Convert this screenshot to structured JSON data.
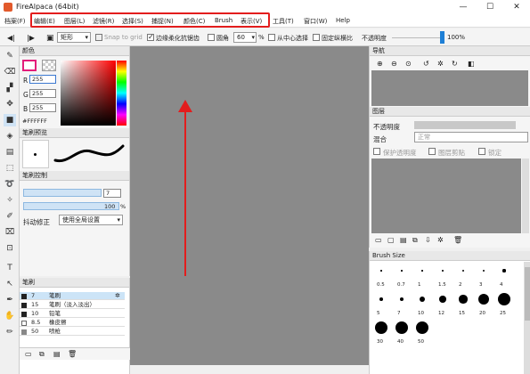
{
  "window": {
    "title": "FireAlpaca (64bit)",
    "minimize": "—",
    "maximize": "☐",
    "close": "✕"
  },
  "menu": [
    "档案(F)",
    "编辑(E)",
    "图层(L)",
    "滤镜(R)",
    "选择(S)",
    "捕捉(N)",
    "颜色(C)",
    "Brush",
    "表示(V)",
    "工具(T)",
    "窗口(W)",
    "Help"
  ],
  "toolbar": {
    "shape": "矩形",
    "snap_label": "Snap to grid",
    "antialias_label": "边缘柔化抗锯齿",
    "circle_label": "圆角",
    "radius_value": "60",
    "radius_unit": "%",
    "from_center_label": "从中心选择",
    "fixed_ratio_label": "固定纵横比",
    "opacity_label": "不透明度",
    "opacity_value": "100%",
    "opacity_fraction": 1.0
  },
  "color_panel": {
    "title": "颜色",
    "r_label": "R",
    "r_value": "255",
    "g_label": "G",
    "g_value": "255",
    "b_label": "B",
    "b_value": "255",
    "hex": "#FFFFFF"
  },
  "brush_preview": {
    "title": "笔刷预览"
  },
  "brush_control": {
    "title": "笔刷控制",
    "size_value": "7",
    "opacity_value": "100",
    "opacity_unit": "%",
    "stabilizer_label": "抖动修正",
    "stabilizer_value": "使用全局设置"
  },
  "brush_list": {
    "title": "笔刷",
    "items": [
      {
        "size": "7",
        "name": "笔刷"
      },
      {
        "size": "15",
        "name": "笔刷（淡入淡出）"
      },
      {
        "size": "10",
        "name": "铅笔"
      },
      {
        "size": "8.5",
        "name": "橡皮擦"
      },
      {
        "size": "50",
        "name": "喷枪"
      }
    ]
  },
  "navigator": {
    "title": "导航"
  },
  "layer_panel": {
    "title": "图层",
    "opacity_label": "不透明度",
    "blend_label": "混合",
    "blend_value": "正常",
    "protect_label": "保护透明度",
    "clip_label": "图层剪贴",
    "lock_label": "锁定"
  },
  "brush_size": {
    "title": "Brush Size",
    "sizes": [
      "0.5",
      "0.7",
      "1",
      "1.5",
      "2",
      "3",
      "4",
      "5",
      "7",
      "10",
      "12",
      "15",
      "20",
      "25",
      "30",
      "40",
      "50"
    ]
  },
  "colors": {
    "accent_bar": "#1e7fd6",
    "highlight": "#e31d1d",
    "canvas": "#8a8a8a",
    "selected_row": "#cce4f7"
  }
}
